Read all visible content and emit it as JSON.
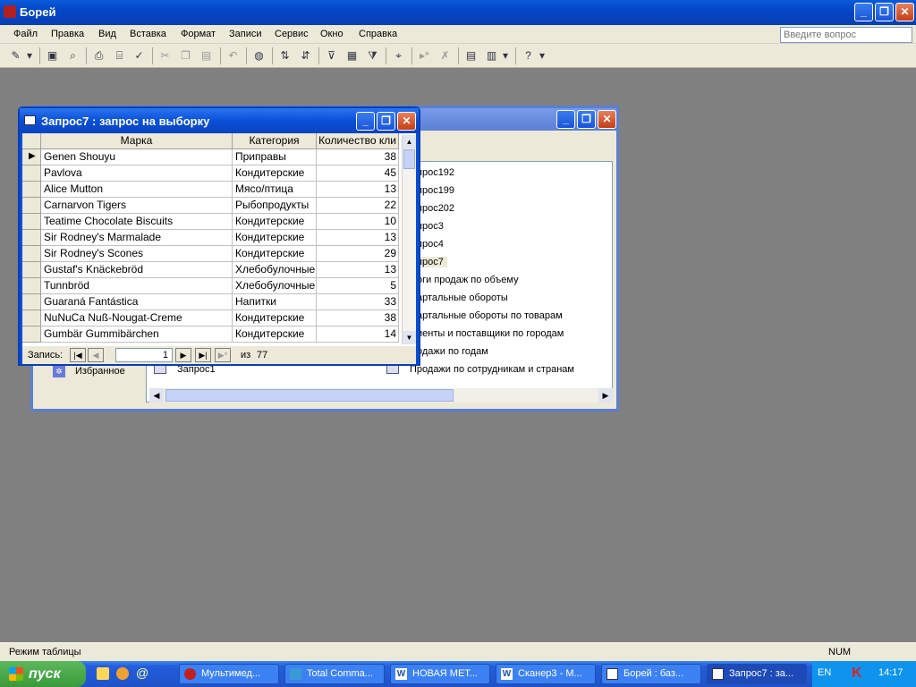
{
  "app": {
    "title": "Борей"
  },
  "menu": [
    "Файл",
    "Правка",
    "Вид",
    "Вставка",
    "Формат",
    "Записи",
    "Сервис",
    "Окно",
    "Справка"
  ],
  "ask": {
    "placeholder": "Введите вопрос"
  },
  "db_window": {
    "left_item": "Избранное",
    "left_bottom_item": "Запрос1",
    "items": [
      "Запрос192",
      "Запрос199",
      "Запрос202",
      "Запрос3",
      "Запрос4",
      "Запрос7",
      "Итоги продаж по объему",
      "Квартальные обороты",
      "Квартальные обороты по товарам",
      "Клиенты и поставщики по городам",
      "Продажи по годам",
      "Продажи по сотрудникам и странам"
    ],
    "visible_items": [
      "прос192",
      "прос199",
      "прос202",
      "прос3",
      "прос4",
      "прос7",
      "оги продаж по объему",
      "артальные обороты",
      "артальные обороты по товарам",
      "иенты и поставщики по городам",
      "одажи по годам",
      "Продажи по сотрудникам и странам"
    ]
  },
  "query_window": {
    "title": "Запрос7 : запрос на выборку",
    "columns": [
      "Марка",
      "Категория",
      "Количество кли"
    ],
    "rows": [
      [
        "Genen Shouyu",
        "Приправы",
        "38"
      ],
      [
        "Pavlova",
        "Кондитерские",
        "45"
      ],
      [
        "Alice Mutton",
        "Мясо/птица",
        "13"
      ],
      [
        "Carnarvon Tigers",
        "Рыбопродукты",
        "22"
      ],
      [
        "Teatime Chocolate Biscuits",
        "Кондитерские",
        "10"
      ],
      [
        "Sir Rodney's Marmalade",
        "Кондитерские",
        "13"
      ],
      [
        "Sir Rodney's Scones",
        "Кондитерские",
        "29"
      ],
      [
        "Gustaf's Knäckebröd",
        "Хлебобулочные",
        "13"
      ],
      [
        "Tunnbröd",
        "Хлебобулочные",
        "5"
      ],
      [
        "Guaraná Fantástica",
        "Напитки",
        "33"
      ],
      [
        "NuNuCa Nuß-Nougat-Creme",
        "Кондитерские",
        "38"
      ],
      [
        "Gumbär Gummibärchen",
        "Кондитерские",
        "14"
      ]
    ],
    "nav_label": "Запись:",
    "record": "1",
    "of_label": "из",
    "total": "77"
  },
  "status": {
    "left": "Режим таблицы",
    "right": "NUM"
  },
  "taskbar": {
    "start": "пуск",
    "tasks": [
      "Мультимед...",
      "Total Comma...",
      "НОВАЯ МЕТ...",
      "Сканер3 - М...",
      "Борей : баз...",
      "Запрос7 : за..."
    ],
    "lang": "EN",
    "clock": "14:17"
  }
}
